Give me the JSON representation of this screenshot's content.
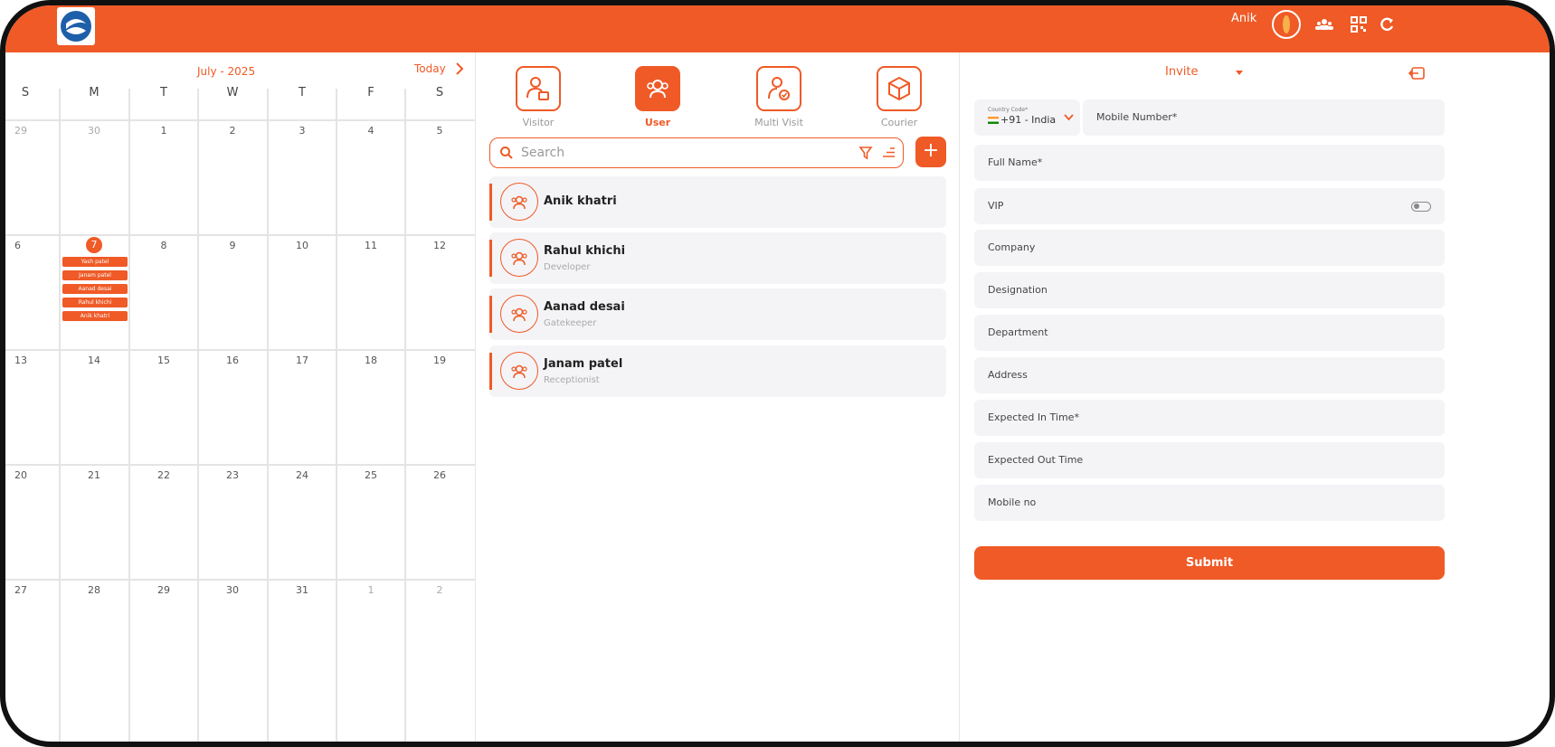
{
  "colors": {
    "accent": "#ef5a27",
    "card_bg": "#f4f4f7"
  },
  "topbar": {
    "user_name": "Anik",
    "icons": [
      "logo-icon",
      "avatar",
      "group-icon",
      "qr-icon",
      "refresh-icon"
    ]
  },
  "calendar": {
    "month_label": "July - 2025",
    "today_label": "Today",
    "weekdays": [
      "S",
      "M",
      "T",
      "W",
      "T",
      "F",
      "S"
    ],
    "weeks": [
      [
        "29",
        "30",
        "1",
        "2",
        "3",
        "4",
        "5"
      ],
      [
        "6",
        "7",
        "8",
        "9",
        "10",
        "11",
        "12"
      ],
      [
        "13",
        "14",
        "15",
        "16",
        "17",
        "18",
        "19"
      ],
      [
        "20",
        "21",
        "22",
        "23",
        "24",
        "25",
        "26"
      ],
      [
        "27",
        "28",
        "29",
        "30",
        "31",
        "1",
        "2"
      ]
    ],
    "events": [
      "Yash patel",
      "Janam patel",
      "Aanad desai",
      "Rahul khichi",
      "Anik khatri"
    ]
  },
  "categories": [
    {
      "label": "Visitor",
      "icon": "visitor-icon",
      "active": false
    },
    {
      "label": "User",
      "icon": "user-group-icon",
      "active": true
    },
    {
      "label": "Multi Visit",
      "icon": "multi-visit-icon",
      "active": false
    },
    {
      "label": "Courier",
      "icon": "courier-box-icon",
      "active": false
    }
  ],
  "search": {
    "placeholder": "Search",
    "add_label": "+"
  },
  "users": [
    {
      "name": "Anik khatri",
      "role": ""
    },
    {
      "name": "Rahul khichi",
      "role": "Developer"
    },
    {
      "name": "Aanad desai",
      "role": "Gatekeeper"
    },
    {
      "name": "Janam patel",
      "role": "Receptionist"
    }
  ],
  "form": {
    "type_label": "Invite",
    "country_code_label": "Country Code*",
    "country_code_value": "+91 - India",
    "fields": [
      "Mobile Number*",
      "Full Name*",
      "VIP",
      "Company",
      "Designation",
      "Department",
      "Address",
      "Expected In Time*",
      "Expected Out Time",
      "Mobile no"
    ],
    "submit_label": "Submit"
  }
}
